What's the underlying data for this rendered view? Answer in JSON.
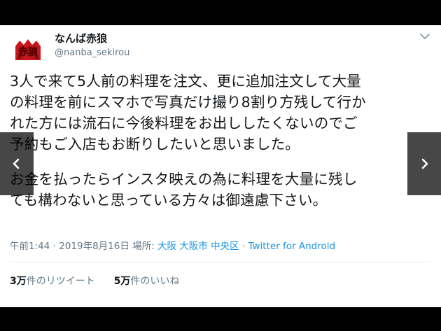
{
  "profile": {
    "avatar_text": "赤狼",
    "display_name": "なんば赤狼",
    "handle": "@nanba_sekirou"
  },
  "tweet": {
    "paragraph1": "3人で来て5人前の料理を注文、更に追加注文して大量\nの料理を前にスマホで写真だけ撮り8割り方残して行か\nれた方には流石に今後料理をお出ししたくないのでご\n予約もご入店もお断りしたいと思いました。",
    "paragraph2": "お金を払ったらインスタ映えの為に料理を大量に残し\nても構わないと思っている方々は御遠慮下さい。"
  },
  "meta": {
    "time": "午前1:44",
    "date": "2019年8月16日",
    "location_label": "場所:",
    "location": "大阪 大阪市 中央区",
    "source": "Twitter for Android"
  },
  "stats": {
    "retweet_count": "3万",
    "retweet_label": "件のリツイート",
    "like_count": "5万",
    "like_label": "件のいいね"
  },
  "icons": {
    "menu": "chevron-down-icon",
    "prev": "chevron-left-icon",
    "next": "chevron-right-icon"
  },
  "colors": {
    "link": "#1b95e0",
    "secondary_text": "#657786",
    "primary_text": "#14171a",
    "avatar_red": "#c8161d"
  }
}
